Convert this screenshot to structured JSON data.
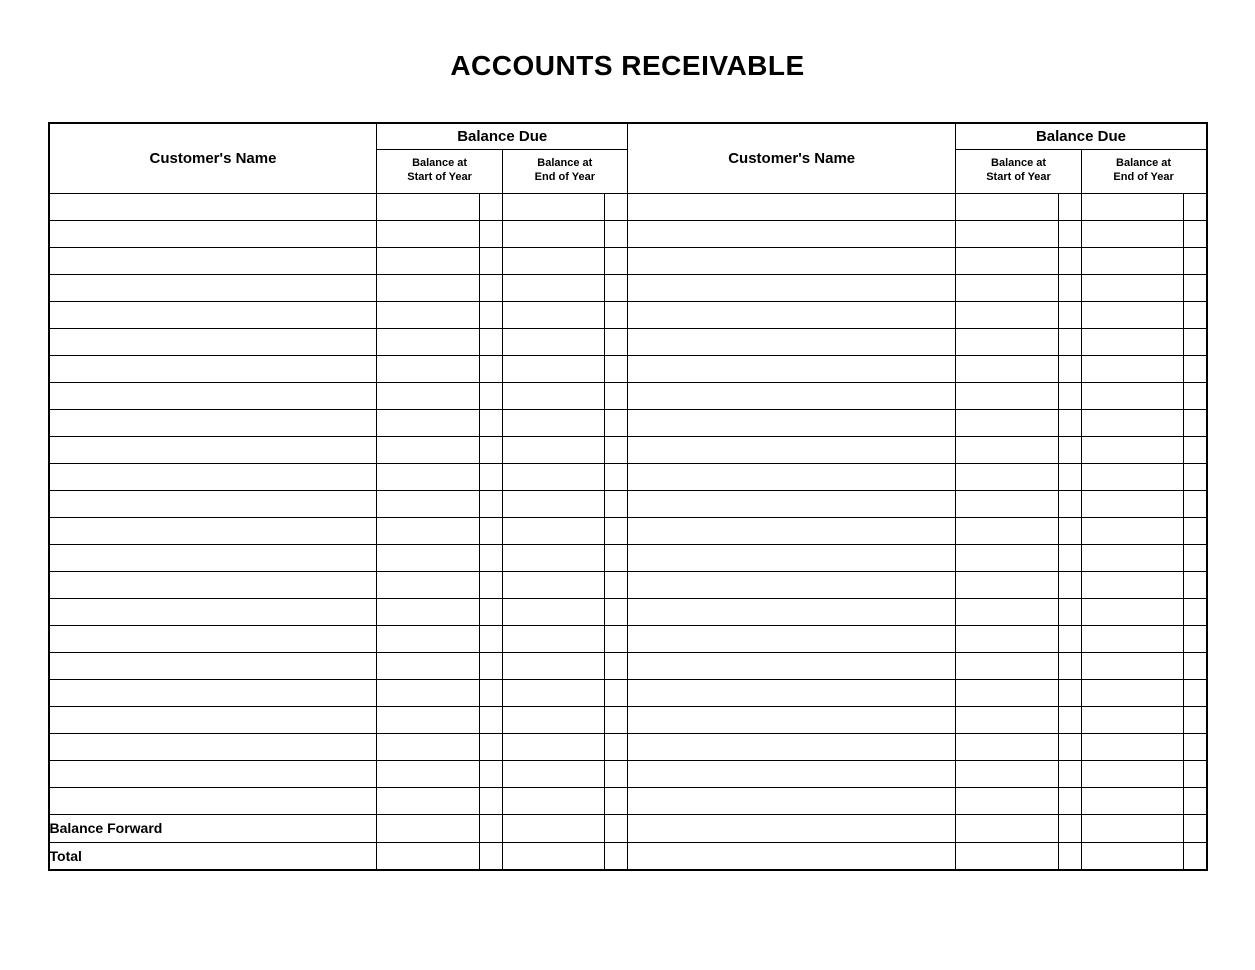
{
  "title": "ACCOUNTS RECEIVABLE",
  "headers": {
    "customer_name": "Customer's Name",
    "balance_due": "Balance Due",
    "balance_start": "Balance at\nStart of Year",
    "balance_end": "Balance at\nEnd of Year"
  },
  "rows": [
    {
      "l_name": "",
      "l_start": "",
      "l_start2": "",
      "l_end": "",
      "l_end2": "",
      "r_name": "",
      "r_start": "",
      "r_start2": "",
      "r_end": "",
      "r_end2": ""
    },
    {
      "l_name": "",
      "l_start": "",
      "l_start2": "",
      "l_end": "",
      "l_end2": "",
      "r_name": "",
      "r_start": "",
      "r_start2": "",
      "r_end": "",
      "r_end2": ""
    },
    {
      "l_name": "",
      "l_start": "",
      "l_start2": "",
      "l_end": "",
      "l_end2": "",
      "r_name": "",
      "r_start": "",
      "r_start2": "",
      "r_end": "",
      "r_end2": ""
    },
    {
      "l_name": "",
      "l_start": "",
      "l_start2": "",
      "l_end": "",
      "l_end2": "",
      "r_name": "",
      "r_start": "",
      "r_start2": "",
      "r_end": "",
      "r_end2": ""
    },
    {
      "l_name": "",
      "l_start": "",
      "l_start2": "",
      "l_end": "",
      "l_end2": "",
      "r_name": "",
      "r_start": "",
      "r_start2": "",
      "r_end": "",
      "r_end2": ""
    },
    {
      "l_name": "",
      "l_start": "",
      "l_start2": "",
      "l_end": "",
      "l_end2": "",
      "r_name": "",
      "r_start": "",
      "r_start2": "",
      "r_end": "",
      "r_end2": ""
    },
    {
      "l_name": "",
      "l_start": "",
      "l_start2": "",
      "l_end": "",
      "l_end2": "",
      "r_name": "",
      "r_start": "",
      "r_start2": "",
      "r_end": "",
      "r_end2": ""
    },
    {
      "l_name": "",
      "l_start": "",
      "l_start2": "",
      "l_end": "",
      "l_end2": "",
      "r_name": "",
      "r_start": "",
      "r_start2": "",
      "r_end": "",
      "r_end2": ""
    },
    {
      "l_name": "",
      "l_start": "",
      "l_start2": "",
      "l_end": "",
      "l_end2": "",
      "r_name": "",
      "r_start": "",
      "r_start2": "",
      "r_end": "",
      "r_end2": ""
    },
    {
      "l_name": "",
      "l_start": "",
      "l_start2": "",
      "l_end": "",
      "l_end2": "",
      "r_name": "",
      "r_start": "",
      "r_start2": "",
      "r_end": "",
      "r_end2": ""
    },
    {
      "l_name": "",
      "l_start": "",
      "l_start2": "",
      "l_end": "",
      "l_end2": "",
      "r_name": "",
      "r_start": "",
      "r_start2": "",
      "r_end": "",
      "r_end2": ""
    },
    {
      "l_name": "",
      "l_start": "",
      "l_start2": "",
      "l_end": "",
      "l_end2": "",
      "r_name": "",
      "r_start": "",
      "r_start2": "",
      "r_end": "",
      "r_end2": ""
    },
    {
      "l_name": "",
      "l_start": "",
      "l_start2": "",
      "l_end": "",
      "l_end2": "",
      "r_name": "",
      "r_start": "",
      "r_start2": "",
      "r_end": "",
      "r_end2": ""
    },
    {
      "l_name": "",
      "l_start": "",
      "l_start2": "",
      "l_end": "",
      "l_end2": "",
      "r_name": "",
      "r_start": "",
      "r_start2": "",
      "r_end": "",
      "r_end2": ""
    },
    {
      "l_name": "",
      "l_start": "",
      "l_start2": "",
      "l_end": "",
      "l_end2": "",
      "r_name": "",
      "r_start": "",
      "r_start2": "",
      "r_end": "",
      "r_end2": ""
    },
    {
      "l_name": "",
      "l_start": "",
      "l_start2": "",
      "l_end": "",
      "l_end2": "",
      "r_name": "",
      "r_start": "",
      "r_start2": "",
      "r_end": "",
      "r_end2": ""
    },
    {
      "l_name": "",
      "l_start": "",
      "l_start2": "",
      "l_end": "",
      "l_end2": "",
      "r_name": "",
      "r_start": "",
      "r_start2": "",
      "r_end": "",
      "r_end2": ""
    },
    {
      "l_name": "",
      "l_start": "",
      "l_start2": "",
      "l_end": "",
      "l_end2": "",
      "r_name": "",
      "r_start": "",
      "r_start2": "",
      "r_end": "",
      "r_end2": ""
    },
    {
      "l_name": "",
      "l_start": "",
      "l_start2": "",
      "l_end": "",
      "l_end2": "",
      "r_name": "",
      "r_start": "",
      "r_start2": "",
      "r_end": "",
      "r_end2": ""
    },
    {
      "l_name": "",
      "l_start": "",
      "l_start2": "",
      "l_end": "",
      "l_end2": "",
      "r_name": "",
      "r_start": "",
      "r_start2": "",
      "r_end": "",
      "r_end2": ""
    },
    {
      "l_name": "",
      "l_start": "",
      "l_start2": "",
      "l_end": "",
      "l_end2": "",
      "r_name": "",
      "r_start": "",
      "r_start2": "",
      "r_end": "",
      "r_end2": ""
    },
    {
      "l_name": "",
      "l_start": "",
      "l_start2": "",
      "l_end": "",
      "l_end2": "",
      "r_name": "",
      "r_start": "",
      "r_start2": "",
      "r_end": "",
      "r_end2": ""
    },
    {
      "l_name": "",
      "l_start": "",
      "l_start2": "",
      "l_end": "",
      "l_end2": "",
      "r_name": "",
      "r_start": "",
      "r_start2": "",
      "r_end": "",
      "r_end2": ""
    }
  ],
  "footer": {
    "balance_forward": "Balance Forward",
    "total": "Total"
  }
}
